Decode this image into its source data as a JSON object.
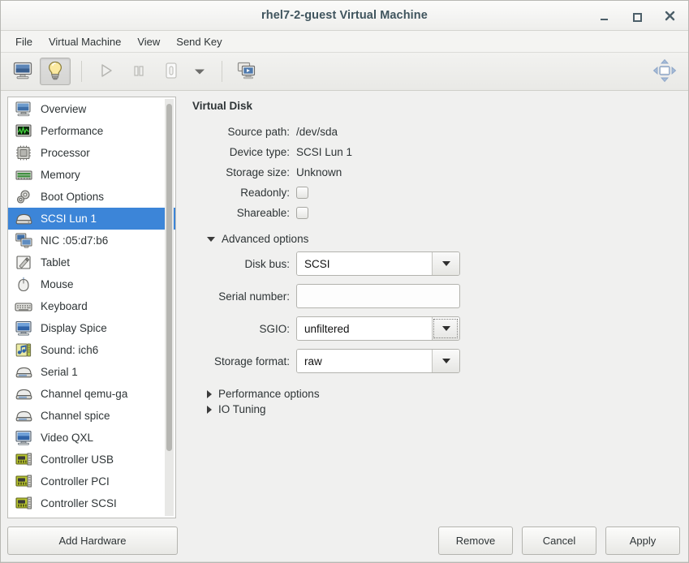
{
  "titlebar": {
    "title": "rhel7-2-guest Virtual Machine",
    "minimize": "minimize-window",
    "maximize": "maximize-window",
    "close": "close-window"
  },
  "menubar": {
    "items": [
      {
        "label": "File"
      },
      {
        "label": "Virtual Machine"
      },
      {
        "label": "View"
      },
      {
        "label": "Send Key"
      }
    ]
  },
  "toolbar": {
    "buttons": [
      {
        "name": "console-view-button",
        "icon": "monitor-icon",
        "pressed": false
      },
      {
        "name": "details-view-button",
        "icon": "lightbulb-icon",
        "pressed": true
      },
      {
        "name": "run-button",
        "icon": "play-icon",
        "pressed": false
      },
      {
        "name": "pause-button",
        "icon": "pause-icon",
        "pressed": false
      },
      {
        "name": "shutdown-button",
        "icon": "power-icon",
        "pressed": false
      },
      {
        "name": "shutdown-menu-button",
        "icon": "chevron-down-icon",
        "pressed": false
      },
      {
        "name": "snapshots-button",
        "icon": "snapshots-icon",
        "pressed": false
      }
    ],
    "fullscreen": {
      "name": "fullscreen-button",
      "icon": "fullscreen-icon"
    }
  },
  "sidebar": {
    "items": [
      {
        "label": "Overview",
        "icon": "computer-icon",
        "selected": false
      },
      {
        "label": "Performance",
        "icon": "graph-icon",
        "selected": false
      },
      {
        "label": "Processor",
        "icon": "cpu-icon",
        "selected": false
      },
      {
        "label": "Memory",
        "icon": "memory-icon",
        "selected": false
      },
      {
        "label": "Boot Options",
        "icon": "gears-icon",
        "selected": false
      },
      {
        "label": "SCSI Lun 1",
        "icon": "harddisk-icon",
        "selected": true
      },
      {
        "label": "NIC :05:d7:b6",
        "icon": "network-icon",
        "selected": false
      },
      {
        "label": "Tablet",
        "icon": "tablet-icon",
        "selected": false
      },
      {
        "label": "Mouse",
        "icon": "mouse-icon",
        "selected": false
      },
      {
        "label": "Keyboard",
        "icon": "keyboard-icon",
        "selected": false
      },
      {
        "label": "Display Spice",
        "icon": "display-icon",
        "selected": false
      },
      {
        "label": "Sound: ich6",
        "icon": "sound-icon",
        "selected": false
      },
      {
        "label": "Serial 1",
        "icon": "serial-icon",
        "selected": false
      },
      {
        "label": "Channel qemu-ga",
        "icon": "channel-icon",
        "selected": false
      },
      {
        "label": "Channel spice",
        "icon": "channel-icon",
        "selected": false
      },
      {
        "label": "Video QXL",
        "icon": "display-icon",
        "selected": false
      },
      {
        "label": "Controller USB",
        "icon": "controller-icon",
        "selected": false
      },
      {
        "label": "Controller PCI",
        "icon": "controller-icon",
        "selected": false
      },
      {
        "label": "Controller SCSI",
        "icon": "controller-icon",
        "selected": false
      }
    ],
    "add_hardware_label": "Add Hardware",
    "selected_color": "#3c85d8"
  },
  "details": {
    "section_title": "Virtual Disk",
    "fields": [
      {
        "label": "Source path:",
        "value": "/dev/sda"
      },
      {
        "label": "Device type:",
        "value": "SCSI Lun 1"
      },
      {
        "label": "Storage size:",
        "value": "Unknown"
      }
    ],
    "checkboxes": [
      {
        "label": "Readonly:",
        "checked": false
      },
      {
        "label": "Shareable:",
        "checked": false
      }
    ],
    "advanced": {
      "label": "Advanced options",
      "expanded": true,
      "rows": [
        {
          "label": "Disk bus:",
          "type": "combo",
          "value": "SCSI",
          "focused": false
        },
        {
          "label": "Serial number:",
          "type": "text",
          "value": "",
          "placeholder": ""
        },
        {
          "label": "SGIO:",
          "type": "combo",
          "value": "unfiltered",
          "focused": true
        },
        {
          "label": "Storage format:",
          "type": "combo",
          "value": "raw",
          "focused": false
        }
      ]
    },
    "expanders": [
      {
        "label": "Performance options",
        "expanded": false
      },
      {
        "label": "IO Tuning",
        "expanded": false
      }
    ]
  },
  "footer": {
    "remove_label": "Remove",
    "cancel_label": "Cancel",
    "apply_label": "Apply"
  }
}
